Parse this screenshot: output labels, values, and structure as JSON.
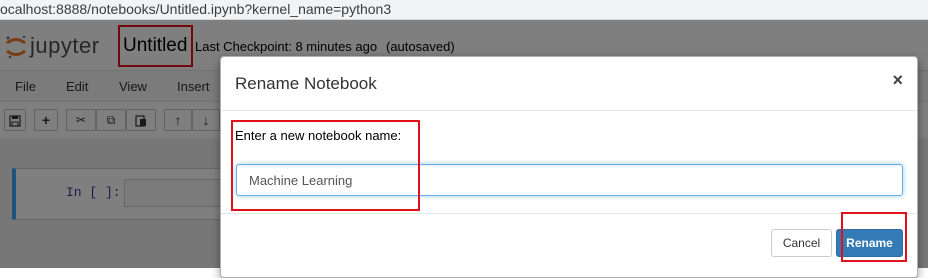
{
  "browser": {
    "url": "ocalhost:8888/notebooks/Untitled.ipynb?kernel_name=python3"
  },
  "header": {
    "logo_text": "jupyter",
    "notebook_title": "Untitled",
    "checkpoint_text": "Last Checkpoint: 8 minutes ago",
    "autosave_text": "(autosaved)"
  },
  "menubar": {
    "items": [
      "File",
      "Edit",
      "View",
      "Insert"
    ]
  },
  "toolbar": {
    "buttons": [
      {
        "icon": "save-icon",
        "glyph": "🖫"
      },
      {
        "icon": "plus-icon",
        "glyph": "+"
      },
      {
        "icon": "scissors-icon",
        "glyph": "✂"
      },
      {
        "icon": "copy-icon",
        "glyph": "⧉"
      },
      {
        "icon": "paste-icon",
        "glyph": "📋"
      },
      {
        "icon": "arrow-up-icon",
        "glyph": "↑"
      },
      {
        "icon": "arrow-down-icon",
        "glyph": "↓"
      }
    ]
  },
  "cell": {
    "prompt": "In [ ]:"
  },
  "modal": {
    "title": "Rename Notebook",
    "close_glyph": "×",
    "label": "Enter a new notebook name:",
    "input_value": "Machine Learning",
    "cancel_label": "Cancel",
    "rename_label": "Rename"
  },
  "colors": {
    "highlight": "#e0111c",
    "primary_button": "#337ab7",
    "cell_border_active": "#42a5f5",
    "logo_orange": "#f37726"
  }
}
